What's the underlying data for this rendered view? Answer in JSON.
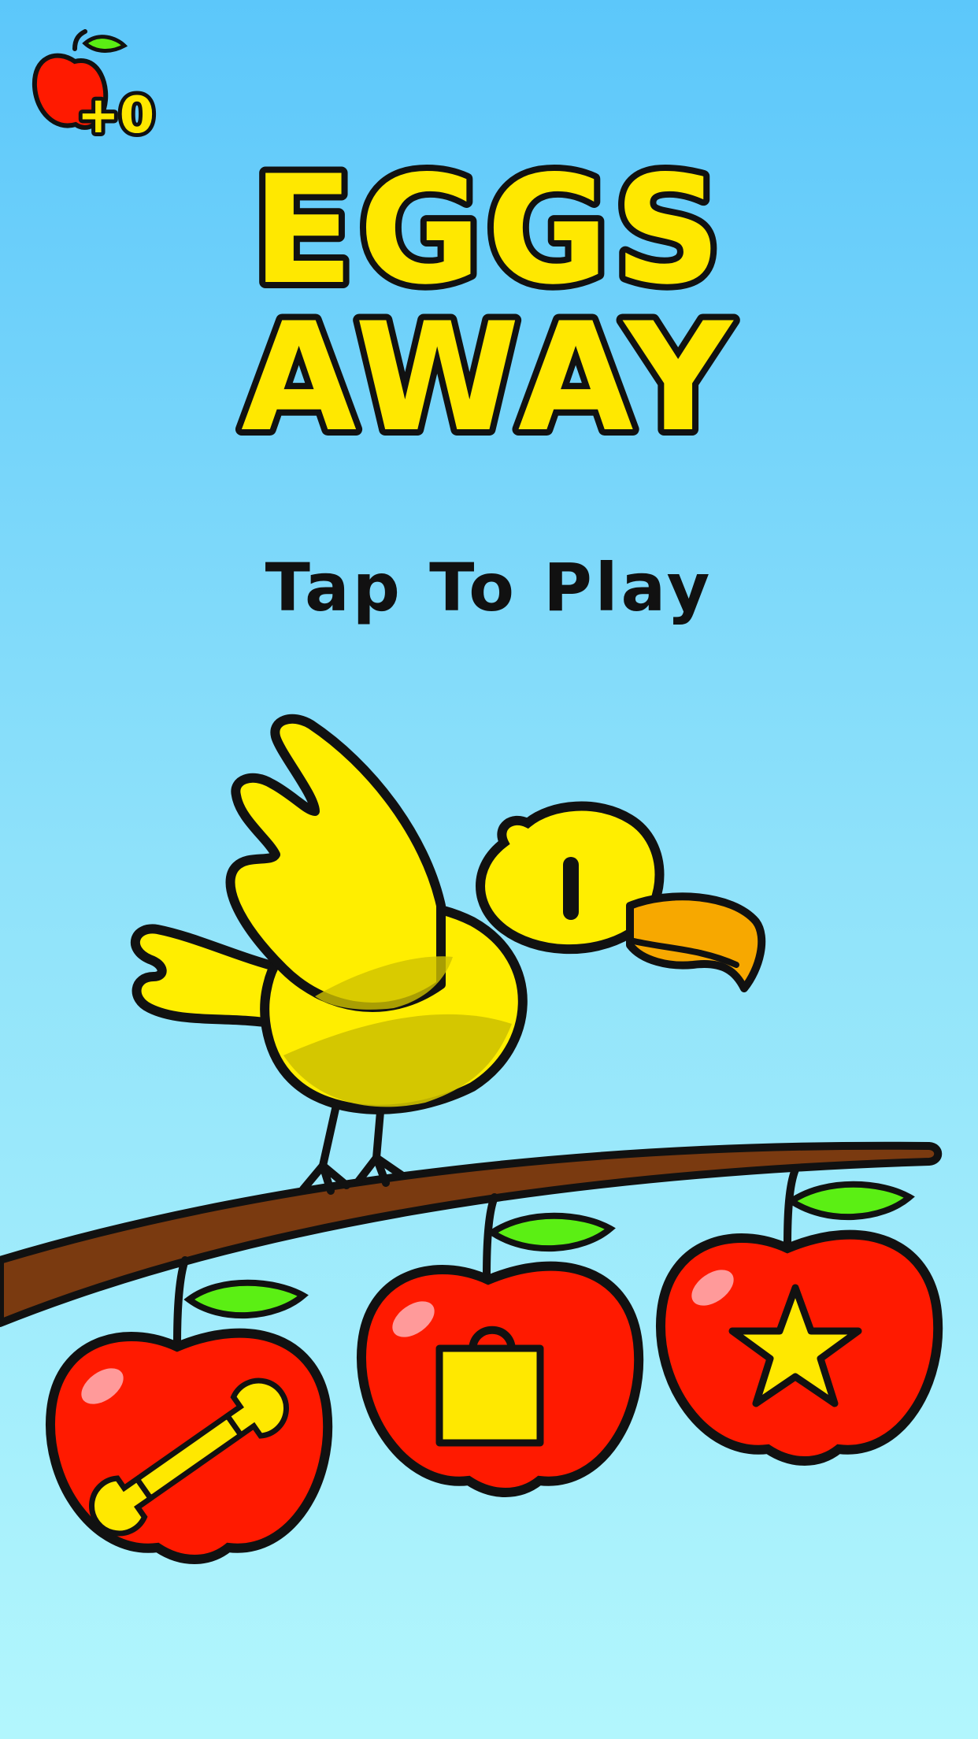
{
  "app": {
    "title_line1": "EGGS",
    "title_line2": "AWAY",
    "prompt": "Tap To Play"
  },
  "hud": {
    "apple_counter": "+0",
    "icon": "apple-icon"
  },
  "menu": {
    "buttons": [
      {
        "icon": "wrench-icon",
        "action": "settings"
      },
      {
        "icon": "shopping-bag-icon",
        "action": "shop"
      },
      {
        "icon": "star-icon",
        "action": "achievements"
      }
    ]
  },
  "colors": {
    "sky_top": "#5CC7FA",
    "sky_bottom": "#B2F6FD",
    "title_fill": "#FFE800",
    "outline": "#111111",
    "apple_red": "#FF1A00",
    "leaf_green": "#5BEF14",
    "branch_brown": "#7A3A10",
    "bird_yellow": "#FFEE00",
    "beak_orange": "#F7A800"
  }
}
